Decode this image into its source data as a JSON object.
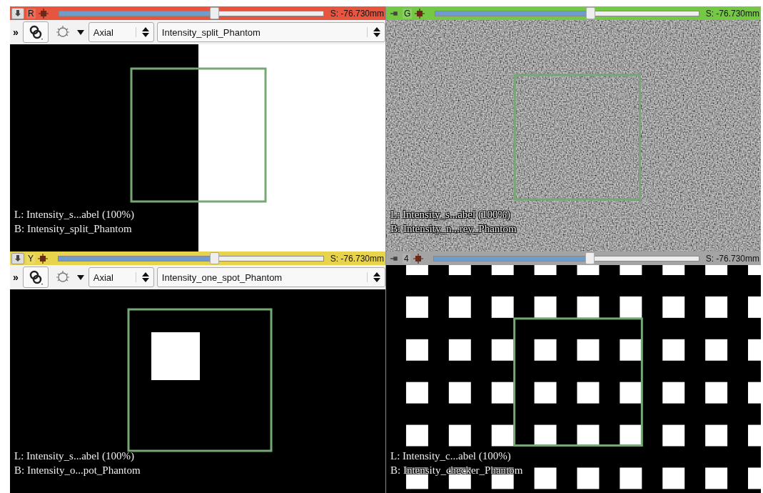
{
  "viewers": [
    {
      "label": "R",
      "color": "#e8553f",
      "pinned": true,
      "level": 0.59,
      "offset": "S: -76.730mm",
      "toolbar": {
        "more": "»",
        "orientation": "Axial",
        "volume": "Intensity_split_Phantom"
      },
      "image": {
        "kind": "split"
      },
      "overlay": [
        "L: Intensity_s...abel (100%)",
        "B: Intensity_split_Phantom"
      ]
    },
    {
      "label": "G",
      "color": "#74c844",
      "pinned": false,
      "level": 0.59,
      "offset": "S: -76.730mm",
      "image": {
        "kind": "noise"
      },
      "overlay": [
        "L: Intensity_s...abel (100%)",
        "B: Intensity_n...rey_Phantom"
      ]
    },
    {
      "label": "Y",
      "color": "#e8d44c",
      "pinned": true,
      "level": 0.59,
      "offset": "S: -76.730mm",
      "toolbar": {
        "more": "»",
        "orientation": "Axial",
        "volume": "Intensity_one_spot_Phantom"
      },
      "image": {
        "kind": "spot"
      },
      "overlay": [
        "L: Intensity_s...abel (100%)",
        "B: Intensity_o...pot_Phantom"
      ]
    },
    {
      "label": "4",
      "color": "#a4a4a4",
      "pinned": false,
      "level": 0.59,
      "offset": "S: -76.730mm",
      "image": {
        "kind": "checker"
      },
      "overlay": [
        "L: Intensity_c...abel (100%)",
        "B: Intensity_checker_Phantom"
      ]
    }
  ]
}
